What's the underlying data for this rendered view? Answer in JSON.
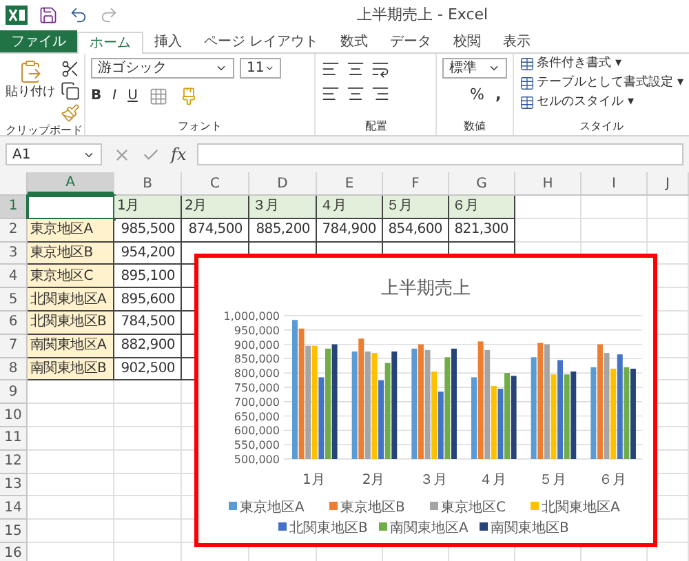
{
  "window": {
    "title": "上半期売上 - Excel"
  },
  "tabs": [
    {
      "label": "ファイル",
      "kind": "file",
      "selected": false
    },
    {
      "label": "ホーム",
      "kind": "tab",
      "selected": true
    },
    {
      "label": "挿入",
      "kind": "tab",
      "selected": false
    },
    {
      "label": "ページ レイアウト",
      "kind": "tab",
      "selected": false
    },
    {
      "label": "数式",
      "kind": "tab",
      "selected": false
    },
    {
      "label": "データ",
      "kind": "tab",
      "selected": false
    },
    {
      "label": "校閲",
      "kind": "tab",
      "selected": false
    },
    {
      "label": "表示",
      "kind": "tab",
      "selected": false
    }
  ],
  "ribbon": {
    "paste": "貼り付け",
    "font_name": "游ゴシック",
    "font_size": "11",
    "bold": "B",
    "italic": "I",
    "underline": "U",
    "number_format": "標準",
    "percent": "%",
    "comma": ",",
    "styles": [
      "条件付き書式 ▾",
      "テーブルとして書式設定 ▾",
      "セルのスタイル ▾"
    ],
    "groups": [
      "クリップボード",
      "フォント",
      "配置",
      "数値",
      "スタイル"
    ]
  },
  "formula_bar": {
    "name_box": "A1",
    "fx": "fx"
  },
  "sheet": {
    "columns": [
      {
        "label": "A",
        "selected": true
      },
      {
        "label": "B",
        "selected": false
      },
      {
        "label": "C",
        "selected": false
      },
      {
        "label": "D",
        "selected": false
      },
      {
        "label": "E",
        "selected": false
      },
      {
        "label": "F",
        "selected": false
      },
      {
        "label": "G",
        "selected": false
      },
      {
        "label": "H",
        "selected": false
      },
      {
        "label": "I",
        "selected": false
      },
      {
        "label": "J",
        "selected": false
      }
    ],
    "rows": [
      {
        "number": "1",
        "kind": "header",
        "selected": true,
        "cells": [
          "",
          "1月",
          "2月",
          "３月",
          "４月",
          "５月",
          "６月"
        ]
      },
      {
        "number": "2",
        "kind": "data",
        "selected": false,
        "cells": [
          "東京地区A",
          "985,500",
          "874,500",
          "885,200",
          "784,900",
          "854,600",
          "821,300"
        ]
      },
      {
        "number": "3",
        "kind": "data",
        "selected": false,
        "cells": [
          "東京地区B",
          "954,200"
        ]
      },
      {
        "number": "4",
        "kind": "data",
        "selected": false,
        "cells": [
          "東京地区C",
          "895,100"
        ]
      },
      {
        "number": "5",
        "kind": "data",
        "selected": false,
        "cells": [
          "北関東地区A",
          "895,600"
        ]
      },
      {
        "number": "6",
        "kind": "data",
        "selected": false,
        "cells": [
          "北関東地区B",
          "784,500"
        ]
      },
      {
        "number": "7",
        "kind": "data",
        "selected": false,
        "cells": [
          "南関東地区A",
          "882,900"
        ]
      },
      {
        "number": "8",
        "kind": "data",
        "selected": false,
        "cells": [
          "南関東地区B",
          "902,500"
        ]
      },
      {
        "number": "9",
        "kind": "empty",
        "selected": false,
        "cells": []
      },
      {
        "number": "10",
        "kind": "empty",
        "selected": false,
        "cells": []
      },
      {
        "number": "11",
        "kind": "empty",
        "selected": false,
        "cells": []
      },
      {
        "number": "12",
        "kind": "empty",
        "selected": false,
        "cells": []
      },
      {
        "number": "13",
        "kind": "empty",
        "selected": false,
        "cells": []
      },
      {
        "number": "14",
        "kind": "empty",
        "selected": false,
        "cells": []
      },
      {
        "number": "15",
        "kind": "empty",
        "selected": false,
        "cells": []
      },
      {
        "number": "16",
        "kind": "empty",
        "selected": false,
        "cells": []
      }
    ]
  },
  "chart": {
    "chart_data": {
      "type": "bar",
      "title": "上半期売上",
      "categories": [
        "1月",
        "2月",
        "３月",
        "４月",
        "５月",
        "６月"
      ],
      "series": [
        {
          "name": "東京地区A",
          "color": "#5b9bd5",
          "values": [
            985000,
            875000,
            885000,
            785000,
            855000,
            820000
          ]
        },
        {
          "name": "東京地区B",
          "color": "#ed7d31",
          "values": [
            955000,
            920000,
            900000,
            910000,
            905000,
            900000
          ]
        },
        {
          "name": "東京地区C",
          "color": "#a5a5a5",
          "values": [
            895000,
            875000,
            880000,
            880000,
            900000,
            870000
          ]
        },
        {
          "name": "北関東地区A",
          "color": "#ffc000",
          "values": [
            895000,
            870000,
            805000,
            755000,
            795000,
            815000
          ]
        },
        {
          "name": "北関東地区B",
          "color": "#4472c4",
          "values": [
            785000,
            775000,
            735000,
            745000,
            845000,
            865000
          ]
        },
        {
          "name": "南関東地区A",
          "color": "#70ad47",
          "values": [
            885000,
            835000,
            855000,
            800000,
            795000,
            820000
          ]
        },
        {
          "name": "南関東地区B",
          "color": "#264478",
          "values": [
            900000,
            875000,
            885000,
            790000,
            805000,
            815000
          ]
        }
      ],
      "ylim": [
        500000,
        1000000
      ],
      "grid": true,
      "legend": "bottom",
      "yticks": [
        {
          "value": 500000,
          "label": "500,000"
        },
        {
          "value": 550000,
          "label": "550,000"
        },
        {
          "value": 600000,
          "label": "600,000"
        },
        {
          "value": 650000,
          "label": "650,000"
        },
        {
          "value": 700000,
          "label": "700,000"
        },
        {
          "value": 750000,
          "label": "750,000"
        },
        {
          "value": 800000,
          "label": "800,000"
        },
        {
          "value": 850000,
          "label": "850,000"
        },
        {
          "value": 900000,
          "label": "900,000"
        },
        {
          "value": 950000,
          "label": "950,000"
        },
        {
          "value": 1000000,
          "label": "1,000,000"
        }
      ]
    }
  }
}
